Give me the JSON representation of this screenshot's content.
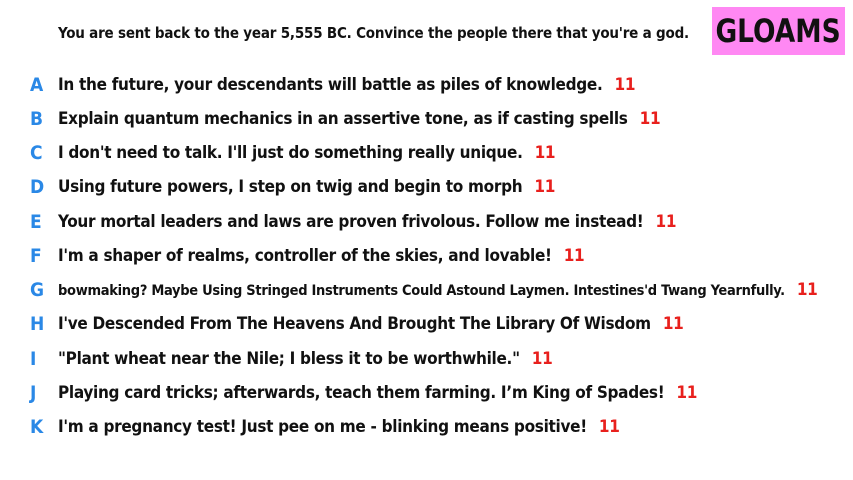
{
  "prompt": "You are sent back to the year 5,555 BC. Convince the people there that you're a god.",
  "badge": "GLOAMS",
  "colors": {
    "badge_bg": "#ff88f3",
    "letter": "#2a88e6",
    "score": "#e8201d"
  },
  "answers": [
    {
      "letter": "A",
      "text": "In the future, your descendants will battle as piles of knowledge.",
      "score": "11"
    },
    {
      "letter": "B",
      "text": "Explain quantum mechanics in an assertive tone, as if casting spells",
      "score": "11"
    },
    {
      "letter": "C",
      "text": "I don't need to talk. I'll just do something really unique.",
      "score": "11"
    },
    {
      "letter": "D",
      "text": "Using future powers, I step on twig and begin to morph",
      "score": "11"
    },
    {
      "letter": "E",
      "text": "Your mortal leaders and laws are proven frivolous. Follow me instead!",
      "score": "11"
    },
    {
      "letter": "F",
      "text": "I'm a shaper of realms, controller of the skies, and lovable!",
      "score": "11"
    },
    {
      "letter": "G",
      "text": "bowmaking? Maybe Using Stringed Instruments Could Astound Laymen. Intestines'd Twang Yearnfully.",
      "score": "11"
    },
    {
      "letter": "H",
      "text": "I've Descended From The Heavens And Brought The Library Of Wisdom",
      "score": "11"
    },
    {
      "letter": "I",
      "text": "\"Plant wheat near the Nile; I bless it to be worthwhile.\"",
      "score": "11"
    },
    {
      "letter": "J",
      "text": "Playing card tricks; afterwards, teach them farming. I’m King of Spades!",
      "score": "11"
    },
    {
      "letter": "K",
      "text": "I'm a pregnancy test! Just pee on me - blinking means positive!",
      "score": "11"
    }
  ]
}
